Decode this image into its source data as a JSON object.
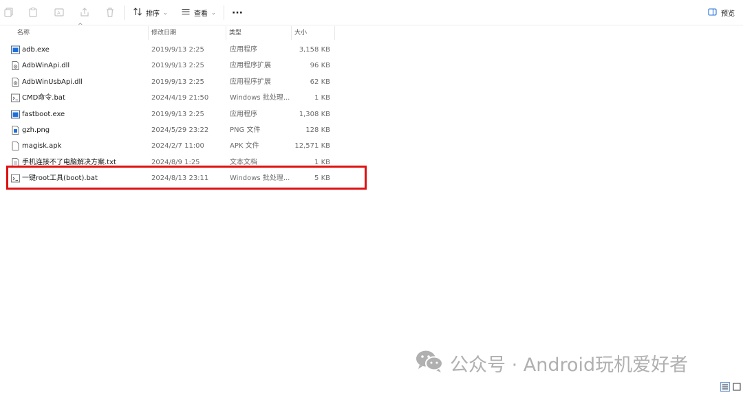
{
  "toolbar": {
    "sort_label": "排序",
    "view_label": "查看",
    "more_label": "···",
    "preview_label": "预览"
  },
  "columns": {
    "name": "名称",
    "date": "修改日期",
    "type": "类型",
    "size": "大小"
  },
  "files": [
    {
      "name": "adb.exe",
      "date": "2019/9/13 2:25",
      "type": "应用程序",
      "size": "3,158 KB",
      "icon": "exe-icon"
    },
    {
      "name": "AdbWinApi.dll",
      "date": "2019/9/13 2:25",
      "type": "应用程序扩展",
      "size": "96 KB",
      "icon": "dll-icon"
    },
    {
      "name": "AdbWinUsbApi.dll",
      "date": "2019/9/13 2:25",
      "type": "应用程序扩展",
      "size": "62 KB",
      "icon": "dll-icon"
    },
    {
      "name": "CMD命令.bat",
      "date": "2024/4/19 21:50",
      "type": "Windows 批处理...",
      "size": "1 KB",
      "icon": "bat-icon"
    },
    {
      "name": "fastboot.exe",
      "date": "2019/9/13 2:25",
      "type": "应用程序",
      "size": "1,308 KB",
      "icon": "exe-icon"
    },
    {
      "name": "gzh.png",
      "date": "2024/5/29 23:22",
      "type": "PNG 文件",
      "size": "128 KB",
      "icon": "png-icon"
    },
    {
      "name": "magisk.apk",
      "date": "2024/2/7 11:00",
      "type": "APK 文件",
      "size": "12,571 KB",
      "icon": "apk-icon"
    },
    {
      "name": "手机连接不了电脑解决方案.txt",
      "date": "2024/8/9 1:25",
      "type": "文本文档",
      "size": "1 KB",
      "icon": "txt-icon"
    },
    {
      "name": "一键root工具(boot).bat",
      "date": "2024/8/13 23:11",
      "type": "Windows 批处理...",
      "size": "5 KB",
      "icon": "bat-icon"
    }
  ],
  "watermark": {
    "text": "公众号 · Android玩机爱好者"
  },
  "colors": {
    "highlight": "#e01010",
    "accent": "#1e6fd9"
  }
}
